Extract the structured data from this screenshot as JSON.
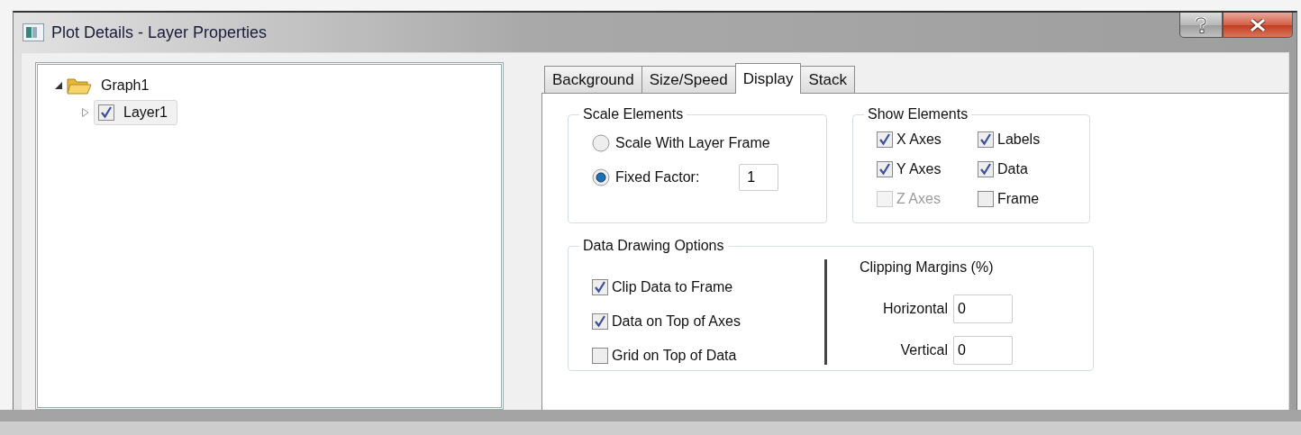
{
  "window": {
    "title": "Plot Details - Layer Properties"
  },
  "tree": [
    {
      "kind": "folder",
      "label": "Graph1",
      "expanded": true,
      "children": [
        {
          "kind": "layer",
          "label": "Layer1",
          "expanded": false,
          "checked": true,
          "selected": true
        }
      ]
    }
  ],
  "tabs": [
    {
      "label": "Background",
      "selected": false
    },
    {
      "label": "Size/Speed",
      "selected": false
    },
    {
      "label": "Display",
      "selected": true
    },
    {
      "label": "Stack",
      "selected": false
    }
  ],
  "scale_elements": {
    "title": "Scale Elements",
    "options": [
      {
        "label": "Scale With Layer Frame",
        "selected": false
      },
      {
        "label": "Fixed Factor:",
        "selected": true
      }
    ],
    "fixed_factor": "1"
  },
  "show_elements": {
    "title": "Show Elements",
    "items": [
      {
        "label": "X Axes",
        "checked": true,
        "disabled": false
      },
      {
        "label": "Labels",
        "checked": true,
        "disabled": false
      },
      {
        "label": "Y Axes",
        "checked": true,
        "disabled": false
      },
      {
        "label": "Data",
        "checked": true,
        "disabled": false
      },
      {
        "label": "Z Axes",
        "checked": false,
        "disabled": true
      },
      {
        "label": "Frame",
        "checked": false,
        "disabled": false
      }
    ]
  },
  "data_drawing": {
    "title": "Data Drawing Options",
    "options": [
      {
        "label": "Clip Data to Frame",
        "checked": true
      },
      {
        "label": "Data on Top of Axes",
        "checked": true
      },
      {
        "label": "Grid on Top of Data",
        "checked": false
      }
    ],
    "clipping": {
      "title": "Clipping Margins (%)",
      "fields": [
        {
          "label": "Horizontal",
          "value": "0"
        },
        {
          "label": "Vertical",
          "value": "0"
        }
      ]
    }
  }
}
